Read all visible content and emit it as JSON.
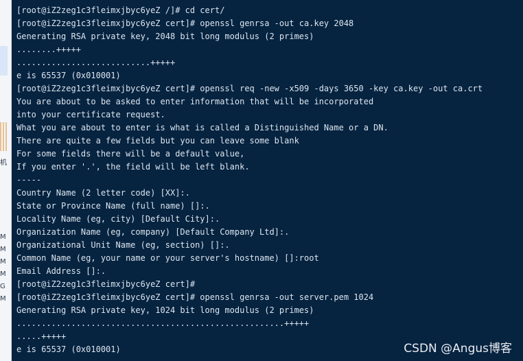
{
  "terminal": {
    "lines": [
      "[root@iZ2zeg1c3fleimxjbyc6yeZ /]# cd cert/",
      "[root@iZ2zeg1c3fleimxjbyc6yeZ cert]# openssl genrsa -out ca.key 2048",
      "Generating RSA private key, 2048 bit long modulus (2 primes)",
      "........+++++",
      "...........................+++++",
      "e is 65537 (0x010001)",
      "[root@iZ2zeg1c3fleimxjbyc6yeZ cert]# openssl req -new -x509 -days 3650 -key ca.key -out ca.crt",
      "You are about to be asked to enter information that will be incorporated",
      "into your certificate request.",
      "What you are about to enter is what is called a Distinguished Name or a DN.",
      "There are quite a few fields but you can leave some blank",
      "For some fields there will be a default value,",
      "If you enter '.', the field will be left blank.",
      "-----",
      "Country Name (2 letter code) [XX]:.",
      "State or Province Name (full name) []:.",
      "Locality Name (eg, city) [Default City]:.",
      "Organization Name (eg, company) [Default Company Ltd]:.",
      "Organizational Unit Name (eg, section) []:.",
      "Common Name (eg, your name or your server's hostname) []:root",
      "Email Address []:.",
      "[root@iZ2zeg1c3fleimxjbyc6yeZ cert]#",
      "[root@iZ2zeg1c3fleimxjbyc6yeZ cert]# openssl genrsa -out server.pem 1024",
      "Generating RSA private key, 1024 bit long modulus (2 primes)",
      "......................................................+++++",
      ".....+++++",
      "e is 65537 (0x010001)"
    ]
  },
  "left_strip": {
    "fragment_1": "机",
    "fragment_2": "M",
    "fragment_3": "M",
    "fragment_4": "M",
    "fragment_5": "M",
    "fragment_6": "G",
    "fragment_7": "M"
  },
  "watermark": "CSDN @Angus博客"
}
